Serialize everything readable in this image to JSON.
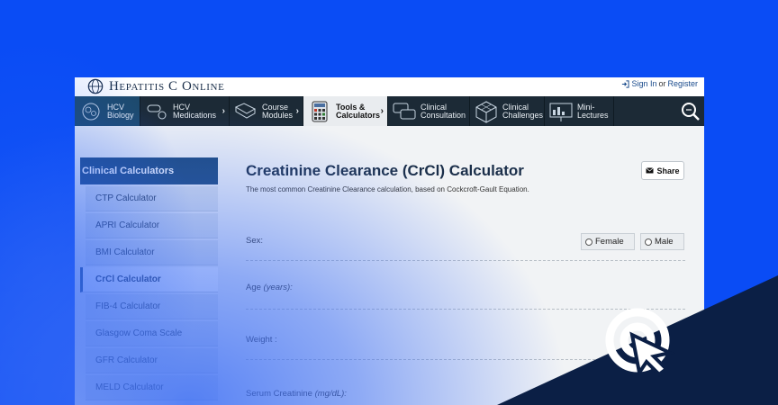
{
  "site": {
    "logo_text": "Hepatitis C Online",
    "signin_label": "Sign In",
    "or_label": "or",
    "register_label": "Register"
  },
  "nav": {
    "items": [
      {
        "label": "HCV\nBiology",
        "icon": "globe-cell-icon"
      },
      {
        "label": "HCV\nMedications",
        "icon": "pills-icon"
      },
      {
        "label": "Course\nModules",
        "icon": "book-icon"
      },
      {
        "label": "Tools &\nCalculators",
        "icon": "calculator-icon",
        "active": true
      },
      {
        "label": "Clinical\nConsultation",
        "icon": "speech-bubbles-icon"
      },
      {
        "label": "Clinical\nChallenges",
        "icon": "cube-icon"
      },
      {
        "label": "Mini-\nLectures",
        "icon": "presentation-icon"
      }
    ]
  },
  "sidebar": {
    "heading": "Clinical Calculators",
    "items": [
      {
        "label": "CTP Calculator"
      },
      {
        "label": "APRI Calculator"
      },
      {
        "label": "BMI Calculator"
      },
      {
        "label": "CrCl Calculator",
        "active": true
      },
      {
        "label": "FIB-4 Calculator"
      },
      {
        "label": "Glasgow Coma Scale"
      },
      {
        "label": "GFR Calculator"
      },
      {
        "label": "MELD Calculator"
      }
    ]
  },
  "main": {
    "title": "Creatinine Clearance (CrCl) Calculator",
    "subtitle": "The most common Creatinine Clearance calculation, based on Cockcroft-Gault Equation.",
    "share_label": "Share",
    "sex_label": "Sex:",
    "female_label": "Female",
    "male_label": "Male",
    "age_label": "Age",
    "age_unit": "(years):",
    "weight_label": "Weight :",
    "creatinine_label": "Serum Creatinine",
    "creatinine_unit": "(mg/dL):"
  },
  "colors": {
    "background": "#0a4cf5",
    "nav": "#1c2a36",
    "brand": "#1d4a7c",
    "corner": "#0b1f45"
  }
}
